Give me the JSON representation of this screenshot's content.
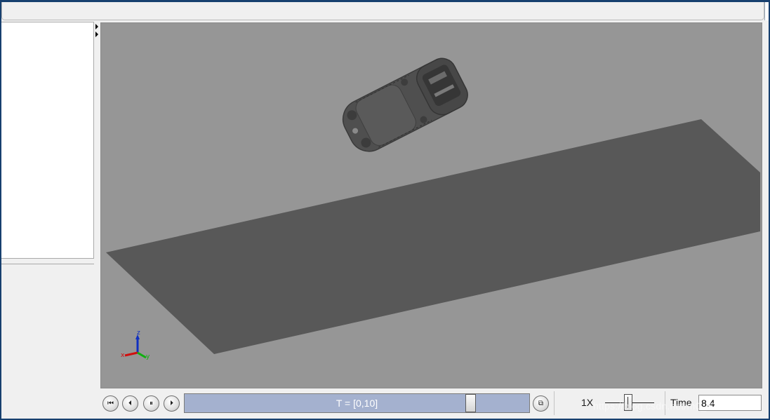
{
  "colors": {
    "viewport_background": "#969696",
    "ground_plane": "#585858",
    "robot_body": "#4e4e4e",
    "timeline_fill": "#a4b1cf",
    "window_border": "#17406f",
    "axis_x": "#d01010",
    "axis_y": "#10b010",
    "axis_z": "#1030c0"
  },
  "viewport": {
    "axis_triad": {
      "x_label": "x",
      "y_label": "y",
      "z_label": "z"
    }
  },
  "playback": {
    "buttons": [
      "skip-to-start-icon",
      "step-back-icon",
      "pause-icon",
      "step-forward-icon"
    ],
    "timeline_label": "T = [0,10]",
    "timeline_position_fraction": 0.84,
    "loop_button": "loop-icon",
    "speed_label": "1X",
    "time_label": "Time",
    "time_value": "8.4"
  },
  "watermark": "https://blog.csdn.net/m0_43046763"
}
